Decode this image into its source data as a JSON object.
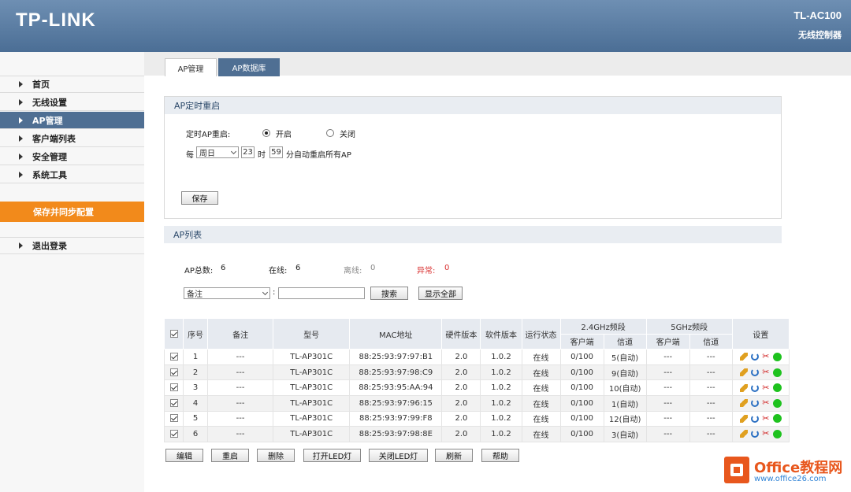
{
  "header": {
    "logo": "TP-LINK",
    "model": "TL-AC100",
    "subtitle": "无线控制器"
  },
  "sidebar": {
    "items": [
      {
        "label": "首页"
      },
      {
        "label": "无线设置"
      },
      {
        "label": "AP管理",
        "active": true
      },
      {
        "label": "客户端列表"
      },
      {
        "label": "安全管理"
      },
      {
        "label": "系统工具"
      }
    ],
    "sync_label": "保存并同步配置",
    "logout_label": "退出登录"
  },
  "tabs": [
    {
      "label": "AP管理",
      "active": true
    },
    {
      "label": "AP数据库"
    }
  ],
  "reboot_panel": {
    "title": "AP定时重启",
    "label": "定时AP重启:",
    "on_label": "开启",
    "off_label": "关闭",
    "selected": "开启",
    "every_label": "每",
    "day_value": "周日",
    "hour_value": "23",
    "hour_label": "时",
    "minute_value": "59",
    "minute_suffix": "分自动重启所有AP",
    "save_label": "保存"
  },
  "ap_list": {
    "title": "AP列表",
    "total_label": "AP总数:",
    "total": "6",
    "online_label": "在线:",
    "online": "6",
    "offline_label": "离线:",
    "offline": "0",
    "abnormal_label": "异常:",
    "abnormal": "0",
    "filter_value": "备注",
    "filter_sep": ":",
    "search_label": "搜索",
    "show_all_label": "显示全部",
    "headers": {
      "index": "序号",
      "note": "备注",
      "model": "型号",
      "mac": "MAC地址",
      "hw": "硬件版本",
      "sw": "软件版本",
      "status": "运行状态",
      "band24": "2.4GHz频段",
      "band5": "5GHz频段",
      "clients": "客户端",
      "channel": "信道",
      "settings": "设置"
    },
    "rows": [
      {
        "index": "1",
        "note": "---",
        "model": "TL-AP301C",
        "mac": "88:25:93:97:97:B1",
        "hw": "2.0",
        "sw": "1.0.2",
        "status": "在线",
        "c24": "0/100",
        "ch24": "5(自动)",
        "c5": "---",
        "ch5": "---"
      },
      {
        "index": "2",
        "note": "---",
        "model": "TL-AP301C",
        "mac": "88:25:93:97:98:C9",
        "hw": "2.0",
        "sw": "1.0.2",
        "status": "在线",
        "c24": "0/100",
        "ch24": "9(自动)",
        "c5": "---",
        "ch5": "---"
      },
      {
        "index": "3",
        "note": "---",
        "model": "TL-AP301C",
        "mac": "88:25:93:95:AA:94",
        "hw": "2.0",
        "sw": "1.0.2",
        "status": "在线",
        "c24": "0/100",
        "ch24": "10(自动)",
        "c5": "---",
        "ch5": "---"
      },
      {
        "index": "4",
        "note": "---",
        "model": "TL-AP301C",
        "mac": "88:25:93:97:96:15",
        "hw": "2.0",
        "sw": "1.0.2",
        "status": "在线",
        "c24": "0/100",
        "ch24": "1(自动)",
        "c5": "---",
        "ch5": "---"
      },
      {
        "index": "5",
        "note": "---",
        "model": "TL-AP301C",
        "mac": "88:25:93:97:99:F8",
        "hw": "2.0",
        "sw": "1.0.2",
        "status": "在线",
        "c24": "0/100",
        "ch24": "12(自动)",
        "c5": "---",
        "ch5": "---"
      },
      {
        "index": "6",
        "note": "---",
        "model": "TL-AP301C",
        "mac": "88:25:93:97:98:8E",
        "hw": "2.0",
        "sw": "1.0.2",
        "status": "在线",
        "c24": "0/100",
        "ch24": "3(自动)",
        "c5": "---",
        "ch5": "---"
      }
    ],
    "actions": [
      "编辑",
      "重启",
      "删除",
      "打开LED灯",
      "关闭LED灯",
      "刷新",
      "帮助"
    ]
  },
  "watermark": {
    "title": "Office教程网",
    "url": "www.office26.com"
  },
  "colors": {
    "header": "#4b6e95",
    "accent": "#f28a1b",
    "active_nav": "#4f6f93",
    "abnormal": "#d93030"
  }
}
